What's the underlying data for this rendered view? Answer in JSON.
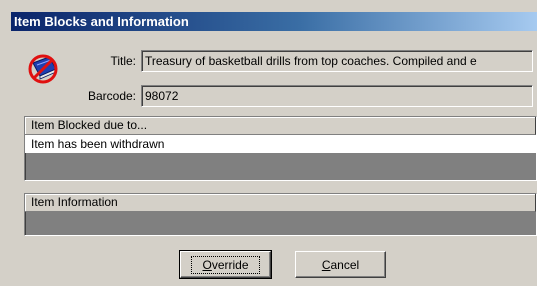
{
  "window": {
    "title": "Item Blocks and Information"
  },
  "icon": "blocked-item-icon",
  "fields": {
    "title_label": "Title:",
    "title_value": "Treasury of basketball drills from top coaches. Compiled and e",
    "barcode_label": "Barcode:",
    "barcode_value": "98072"
  },
  "blocked_panel": {
    "header": "Item Blocked due to...",
    "rows": [
      "Item has been withdrawn"
    ]
  },
  "info_panel": {
    "header": "Item Information",
    "rows": []
  },
  "buttons": {
    "override_mnemonic": "O",
    "override_rest": "verride",
    "cancel_mnemonic": "C",
    "cancel_rest": "ancel"
  },
  "colors": {
    "face": "#d4d0c8",
    "titlebar_start": "#0a246a",
    "titlebar_end": "#a6caf0",
    "list_background": "#808080"
  }
}
